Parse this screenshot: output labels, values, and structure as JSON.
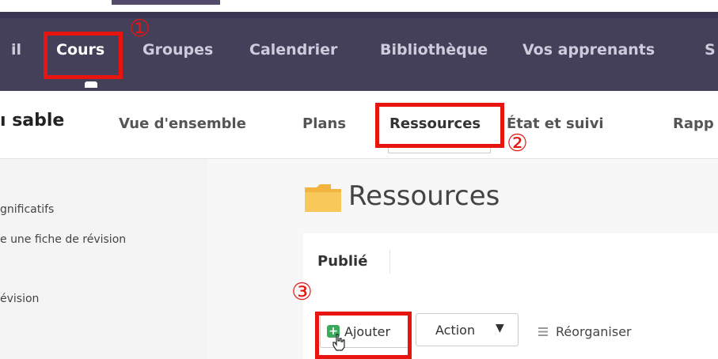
{
  "top_nav": {
    "items": [
      {
        "label": "il",
        "active": false
      },
      {
        "label": "Cours",
        "active": true
      },
      {
        "label": "Groupes",
        "active": false
      },
      {
        "label": "Calendrier",
        "active": false
      },
      {
        "label": "Bibliothèque",
        "active": false
      },
      {
        "label": "Vos apprenants",
        "active": false
      },
      {
        "label": "S",
        "active": false
      }
    ],
    "background": "#45405a"
  },
  "course": {
    "title_fragment": "ı sable"
  },
  "sub_nav": {
    "items": [
      {
        "label": "Vue d'ensemble",
        "active": false
      },
      {
        "label": "Plans",
        "active": false
      },
      {
        "label": "Ressources",
        "active": true
      },
      {
        "label": "État et suivi",
        "active": false
      },
      {
        "label": "Rapp",
        "active": false
      }
    ]
  },
  "sidebar": {
    "items": [
      {
        "label": "gnificatifs"
      },
      {
        "label": "e une fiche de révision"
      },
      {
        "label": "évision"
      }
    ]
  },
  "main": {
    "heading": "Ressources",
    "heading_icon": "folder-icon",
    "tabs": [
      {
        "label": "Publié",
        "active": true
      }
    ],
    "toolbar": {
      "add_label": "Ajouter",
      "add_icon": "plus-icon",
      "action_label": "Action",
      "action_icon": "caret-down-icon",
      "reorganize_label": "Réorganiser",
      "reorganize_icon": "drag-lines-icon"
    }
  },
  "annotations": {
    "color": "#e8140f",
    "steps": [
      "①",
      "②",
      "③"
    ]
  }
}
